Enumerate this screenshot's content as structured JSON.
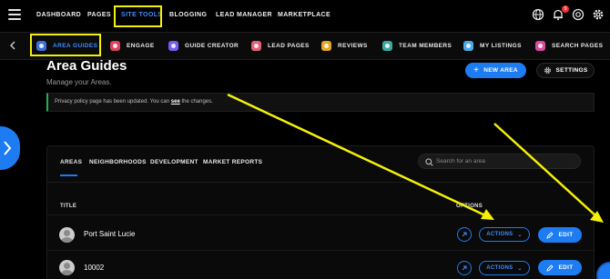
{
  "topnav": {
    "items": [
      "DASHBOARD",
      "PAGES",
      "SITE TOOLS",
      "BLOGGING",
      "LEAD MANAGER",
      "MARKETPLACE"
    ],
    "active": "SITE TOOLS",
    "notification_count": "9"
  },
  "subnav": {
    "items": [
      {
        "label": "AREA GUIDES",
        "icon": "area-guides-icon",
        "color": "#3f6fd8"
      },
      {
        "label": "ENGAGE",
        "icon": "engage-icon",
        "color": "#d9445c"
      },
      {
        "label": "GUIDE CREATOR",
        "icon": "guide-creator-icon",
        "color": "#7a5cf0"
      },
      {
        "label": "LEAD PAGES",
        "icon": "lead-pages-icon",
        "color": "#e0607a"
      },
      {
        "label": "REVIEWS",
        "icon": "reviews-icon",
        "color": "#e6a623"
      },
      {
        "label": "TEAM MEMBERS",
        "icon": "team-members-icon",
        "color": "#3fa6a0"
      },
      {
        "label": "MY LISTINGS",
        "icon": "my-listings-icon",
        "color": "#4aa9e8"
      },
      {
        "label": "SEARCH PAGES",
        "icon": "search-pages-icon",
        "color": "#d94aa0"
      }
    ]
  },
  "header": {
    "title": "Area Guides",
    "subtitle": "Manage your Areas.",
    "new_area_label": "NEW AREA",
    "settings_label": "SETTINGS"
  },
  "notice": {
    "text_before": "Privacy policy page has been updated. You can",
    "link": "see",
    "text_after": "the changes."
  },
  "tabs": [
    "AREAS",
    "NEIGHBORHOODS",
    "DEVELOPMENT",
    "MARKET REPORTS"
  ],
  "search": {
    "placeholder": "Search for an area"
  },
  "table": {
    "col_title": "TITLE",
    "col_options": "OPTIONS",
    "actions_label": "ACTIONS",
    "edit_label": "EDIT",
    "rows": [
      {
        "title": "Port Saint Lucie"
      },
      {
        "title": "10002"
      }
    ]
  },
  "colors": {
    "accent": "#1e7cf2",
    "highlight": "#f4f00a",
    "notice_bar": "#23b04b"
  }
}
